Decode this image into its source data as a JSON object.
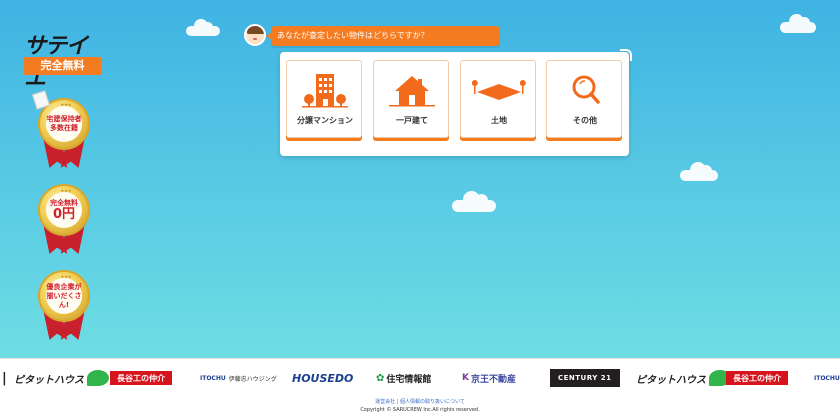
{
  "brand": {
    "logo_text": "サテイエ",
    "free_badge": "完全無料",
    "accent_color": "#f47b20",
    "sky_color": "#3fb3e3"
  },
  "medals": [
    {
      "line1": "宅建保持者",
      "line2": "多数在籍",
      "big": ""
    },
    {
      "line1": "完全無料",
      "line2": "",
      "big": "0円"
    },
    {
      "line1": "優良企業が",
      "line2": "揃いだくさん!",
      "big": ""
    }
  ],
  "prompt": {
    "question": "あなたが査定したい物件はどちらですか？"
  },
  "property_types": [
    {
      "label": "分譲マンション",
      "icon": "apartment-building-icon"
    },
    {
      "label": "一戸建て",
      "icon": "house-icon"
    },
    {
      "label": "土地",
      "icon": "land-plot-icon"
    },
    {
      "label": "その他",
      "icon": "search-icon"
    }
  ],
  "partners": [
    {
      "name": "ピタットハウス"
    },
    {
      "name": "長谷工の仲介"
    },
    {
      "name": "伊藤忠ハウジング"
    },
    {
      "name": "HOUSEDO"
    },
    {
      "name": "住宅情報館"
    },
    {
      "name": "京王不動産"
    },
    {
      "name": "CENTURY 21"
    },
    {
      "name": "ピタットハウス"
    },
    {
      "name": "長谷工の仲介"
    },
    {
      "name": "ITOCHU"
    }
  ],
  "footer": {
    "links": "運営会社 | 個人情報の取り扱いについて",
    "copyright": "Copyright © SARUCREW Inc.All rights reserved."
  }
}
